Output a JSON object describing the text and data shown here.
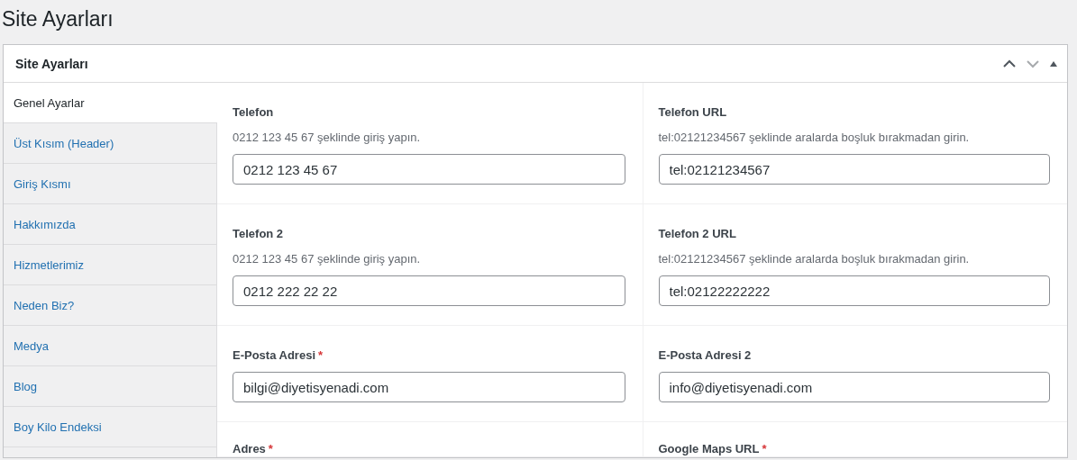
{
  "page_title": "Site Ayarları",
  "panel": {
    "title": "Site Ayarları"
  },
  "sidebar": {
    "items": [
      {
        "label": "Genel Ayarlar",
        "selected": true
      },
      {
        "label": "Üst Kısım (Header)",
        "selected": false
      },
      {
        "label": "Giriş Kısmı",
        "selected": false
      },
      {
        "label": "Hakkımızda",
        "selected": false
      },
      {
        "label": "Hizmetlerimiz",
        "selected": false
      },
      {
        "label": "Neden Biz?",
        "selected": false
      },
      {
        "label": "Medya",
        "selected": false
      },
      {
        "label": "Blog",
        "selected": false
      },
      {
        "label": "Boy Kilo Endeksi",
        "selected": false
      }
    ]
  },
  "rows": [
    [
      {
        "label": "Telefon",
        "description": "0212 123 45 67 şeklinde giriş yapın.",
        "value": "0212 123 45 67"
      },
      {
        "label": "Telefon URL",
        "description": "tel:02121234567 şeklinde aralarda boşluk bırakmadan girin.",
        "value": "tel:02121234567"
      }
    ],
    [
      {
        "label": "Telefon 2",
        "description": "0212 123 45 67 şeklinde giriş yapın.",
        "value": "0212 222 22 22"
      },
      {
        "label": "Telefon 2 URL",
        "description": "tel:02121234567 şeklinde aralarda boşluk bırakmadan girin.",
        "value": "tel:02122222222"
      }
    ],
    [
      {
        "label": "E-Posta Adresi",
        "required_mark": "*",
        "value": "bilgi@diyetisyenadi.com"
      },
      {
        "label": "E-Posta Adresi 2",
        "value": "info@diyetisyenadi.com"
      }
    ],
    [
      {
        "label": "Adres",
        "required_mark": "*"
      },
      {
        "label": "Google Maps URL",
        "required_mark": "*"
      }
    ]
  ]
}
